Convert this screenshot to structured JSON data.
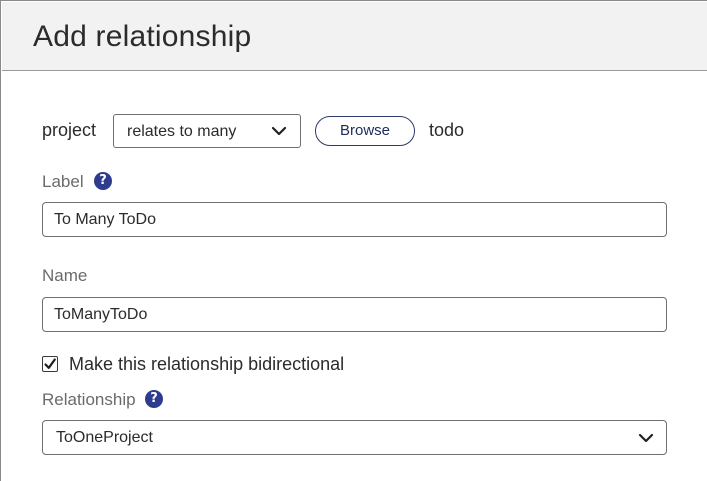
{
  "dialog": {
    "title": "Add relationship"
  },
  "relationship_row": {
    "source_entity": "project",
    "type_select_value": "relates to many",
    "browse_label": "Browse",
    "target_entity": "todo"
  },
  "label_field": {
    "label": "Label",
    "value": "To Many ToDo",
    "help_icon": "question-circle-icon"
  },
  "name_field": {
    "label": "Name",
    "value": "ToManyToDo"
  },
  "bidirectional": {
    "checked": true,
    "label": "Make this relationship bidirectional"
  },
  "relationship_field": {
    "label": "Relationship",
    "select_value": "ToOneProject",
    "help_icon": "question-circle-icon"
  },
  "colors": {
    "accent": "#2e3c8f",
    "header_bg": "#f2f2f2",
    "border": "#6f6f6f"
  }
}
